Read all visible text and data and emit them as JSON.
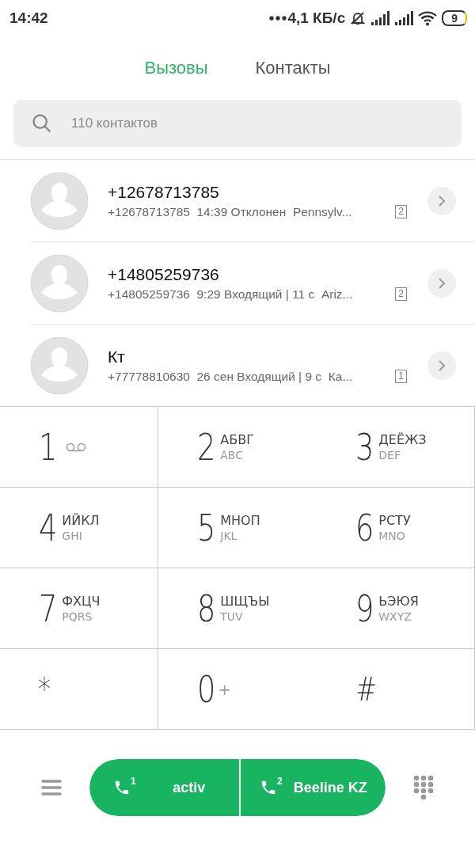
{
  "status_bar": {
    "time": "14:42",
    "speed": "4,1 КБ/с",
    "battery": "9"
  },
  "tabs": [
    {
      "label": "Вызовы",
      "selected": true
    },
    {
      "label": "Контакты",
      "selected": false
    }
  ],
  "search": {
    "placeholder": "110 контактов"
  },
  "calls": [
    {
      "name": "+12678713785",
      "details": "+12678713785  14:39 Отклонен  Pennsylv...",
      "sim": "2"
    },
    {
      "name": "+14805259736",
      "details": "+14805259736  9:29 Входящий | 11 с  Ariz...",
      "sim": "2"
    },
    {
      "name": "Кт",
      "details": "+77778810630  26 сен Входящий | 9 с  Ка...",
      "sim": "1"
    }
  ],
  "keypad": [
    {
      "kind": "voicemail",
      "digit": "1"
    },
    {
      "kind": "letters",
      "digit": "2",
      "letters": "АБВГ",
      "latin": "ABC"
    },
    {
      "kind": "letters",
      "digit": "3",
      "letters": "ДЕЁЖЗ",
      "latin": "DEF"
    },
    {
      "kind": "letters",
      "digit": "4",
      "letters": "ИЙКЛ",
      "latin": "GHI"
    },
    {
      "kind": "letters",
      "digit": "5",
      "letters": "МНОП",
      "latin": "JKL"
    },
    {
      "kind": "letters",
      "digit": "6",
      "letters": "РСТУ",
      "latin": "MNO"
    },
    {
      "kind": "letters",
      "digit": "7",
      "letters": "ФХЦЧ",
      "latin": "PQRS"
    },
    {
      "kind": "letters",
      "digit": "8",
      "letters": "ШЩЪЫ",
      "latin": "TUV"
    },
    {
      "kind": "letters",
      "digit": "9",
      "letters": "ЬЭЮЯ",
      "latin": "WXYZ"
    },
    {
      "kind": "symbol",
      "digit": "*"
    },
    {
      "kind": "plus",
      "digit": "0",
      "extra": "+"
    },
    {
      "kind": "symbol",
      "digit": "#"
    }
  ],
  "call_buttons": [
    {
      "sim": "1",
      "label": "activ"
    },
    {
      "sim": "2",
      "label": "Beeline KZ"
    }
  ]
}
